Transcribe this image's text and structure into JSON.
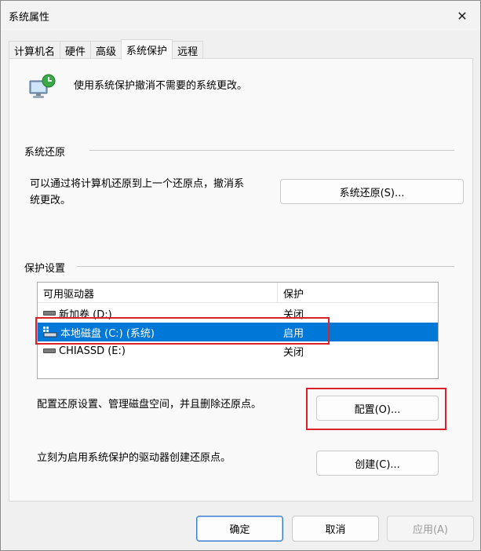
{
  "window": {
    "title": "系统属性",
    "close_glyph": "✕"
  },
  "tabs": [
    {
      "label": "计算机名"
    },
    {
      "label": "硬件"
    },
    {
      "label": "高级"
    },
    {
      "label": "系统保护",
      "active": true
    },
    {
      "label": "远程"
    }
  ],
  "intro": {
    "text": "使用系统保护撤消不需要的系统更改。",
    "icon": "system-protection-icon"
  },
  "restore": {
    "group_label": "系统还原",
    "description_line1": "可以通过将计算机还原到上一个还原点，撤消系",
    "description_line2": "统更改。",
    "button_label": "系统还原(S)..."
  },
  "protection": {
    "group_label": "保护设置",
    "columns": [
      "可用驱动器",
      "保护"
    ],
    "drives": [
      {
        "name": "新加卷 (D:)",
        "status": "关闭",
        "icon": "drive-icon"
      },
      {
        "name": "本地磁盘 (C:) (系统)",
        "status": "启用",
        "icon": "system-drive-icon",
        "selected": true
      },
      {
        "name": "CHIASSD (E:)",
        "status": "关闭",
        "icon": "drive-icon"
      }
    ],
    "configure_text": "配置还原设置、管理磁盘空间，并且删除还原点。",
    "configure_button": "配置(O)...",
    "create_text": "立刻为启用系统保护的驱动器创建还原点。",
    "create_button": "创建(C)..."
  },
  "footer": {
    "ok": "确定",
    "cancel": "取消",
    "apply": "应用(A)"
  },
  "colors": {
    "selection": "#0078d7",
    "highlight_box": "#d9222a",
    "panel_bg": "#f9f9f9",
    "window_bg": "#f0f0f0"
  }
}
